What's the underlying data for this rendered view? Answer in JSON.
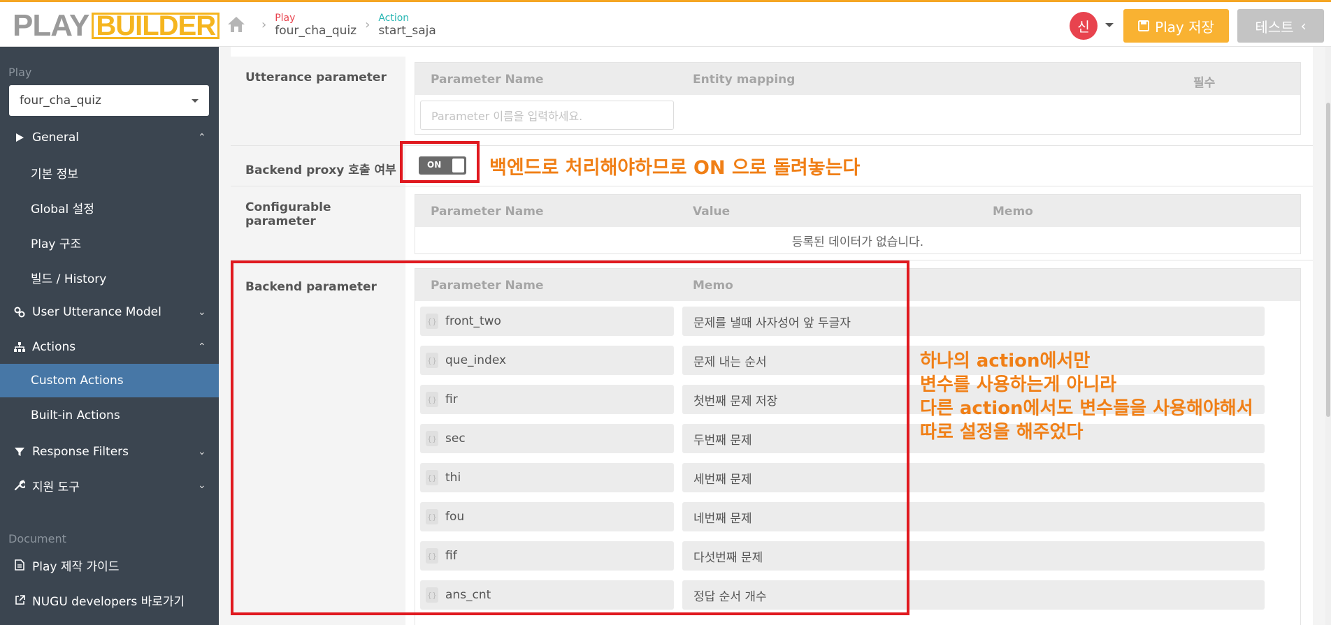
{
  "header": {
    "logo_play": "PLAY",
    "logo_builder": "BUILDER",
    "breadcrumb": [
      {
        "key": "Play",
        "value": "four_cha_quiz"
      },
      {
        "key": "Action",
        "value": "start_saja"
      }
    ],
    "avatar": "신",
    "save_label": "Play 저장",
    "test_label": "테스트"
  },
  "sidebar": {
    "play_section": "Play",
    "play_select": "four_cha_quiz",
    "items": [
      {
        "label": "General"
      },
      {
        "label": "기본 정보"
      },
      {
        "label": "Global 설정"
      },
      {
        "label": "Play 구조"
      },
      {
        "label": "빌드 / History"
      },
      {
        "label": "User Utterance Model"
      },
      {
        "label": "Actions"
      },
      {
        "label": "Custom Actions"
      },
      {
        "label": "Built-in Actions"
      },
      {
        "label": "Response Filters"
      },
      {
        "label": "지원 도구"
      }
    ],
    "document_section": "Document",
    "docs": [
      {
        "label": "Play 제작 가이드"
      },
      {
        "label": "NUGU developers 바로가기"
      }
    ]
  },
  "utterance": {
    "label": "Utterance parameter",
    "cols": [
      "Parameter Name",
      "Entity mapping",
      "필수"
    ],
    "placeholder": "Parameter 이름을 입력하세요."
  },
  "backend_proxy": {
    "label": "Backend proxy 호출 여부",
    "toggle": "ON"
  },
  "configurable": {
    "label": "Configurable parameter",
    "cols": [
      "Parameter Name",
      "Value",
      "Memo"
    ],
    "empty": "등록된 데이터가 없습니다."
  },
  "backend": {
    "label": "Backend parameter",
    "cols": [
      "Parameter Name",
      "Memo"
    ],
    "rows": [
      {
        "name": "front_two",
        "memo": "문제를 낼때 사자성어 앞 두글자"
      },
      {
        "name": "que_index",
        "memo": "문제 내는 순서"
      },
      {
        "name": "fir",
        "memo": "첫번째 문제 저장"
      },
      {
        "name": "sec",
        "memo": "두번째 문제"
      },
      {
        "name": "thi",
        "memo": "세번째 문제"
      },
      {
        "name": "fou",
        "memo": "네번째 문제"
      },
      {
        "name": "fif",
        "memo": "다섯번째 문제"
      },
      {
        "name": "ans_cnt",
        "memo": "정답 순서 개수"
      }
    ]
  },
  "annotations": {
    "note1": "백엔드로 처리해야하므로 ON 으로 돌려놓는다",
    "note2": [
      "하나의 action에서만",
      "변수를 사용하는게 아니라",
      "다른 action에서도 변수들을 사용해야해서",
      "따로 설정을 해주었다"
    ]
  },
  "colors": {
    "accent": "#f9b232",
    "active": "#4777a6",
    "annotation_red": "#e0191f",
    "annotation_orange": "#f07f16"
  }
}
